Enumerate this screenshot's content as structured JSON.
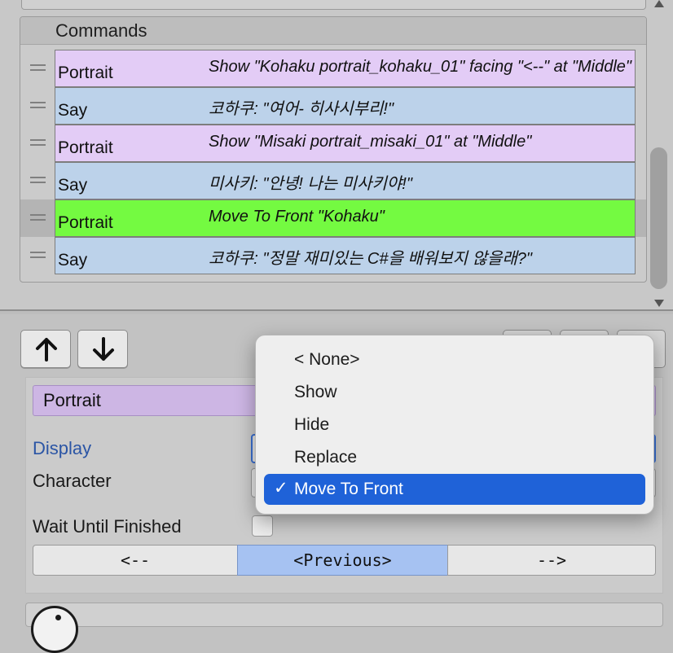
{
  "commands_panel": {
    "header": "Commands",
    "rows": [
      {
        "name": "Portrait",
        "desc": "Show \"Kohaku portrait_kohaku_01\" facing \"<--\" at \"Middle\"",
        "kind": "portrait",
        "selected": false
      },
      {
        "name": "Say",
        "desc": "코하쿠: \"여어- 히사시부리!\"",
        "kind": "say",
        "selected": false
      },
      {
        "name": "Portrait",
        "desc": "Show \"Misaki portrait_misaki_01\" at \"Middle\"",
        "kind": "portrait",
        "selected": false
      },
      {
        "name": "Say",
        "desc": "미사키: \"안녕! 나는 미사키야!\"",
        "kind": "say",
        "selected": false
      },
      {
        "name": "Portrait",
        "desc": "Move To Front \"Kohaku\"",
        "kind": "active",
        "selected": true
      },
      {
        "name": "Say",
        "desc": "코하쿠: \"정말 재미있는 C#을 배워보지 않을래?\"",
        "kind": "say",
        "selected": false
      }
    ]
  },
  "toolbar": {
    "up_icon": "arrow-up-icon",
    "down_icon": "arrow-down-icon"
  },
  "inspector": {
    "command_title": "Portrait",
    "display_label": "Display",
    "character_label": "Character",
    "wait_label": "Wait Until Finished",
    "wait_checked": false,
    "facing_buttons": [
      "<--",
      "<Previous>",
      "-->"
    ],
    "facing_selected": "<Previous>"
  },
  "dropdown": {
    "options": [
      "< None>",
      "Show",
      "Hide",
      "Replace",
      "Move To Front"
    ],
    "selected": "Move To Front",
    "check_mark": "✓"
  },
  "colors": {
    "portrait": "#e3ccf6",
    "say": "#bcd2ea",
    "active": "#74fa41",
    "selection_blue": "#1f62d8",
    "focus_label": "#2b55a5"
  }
}
